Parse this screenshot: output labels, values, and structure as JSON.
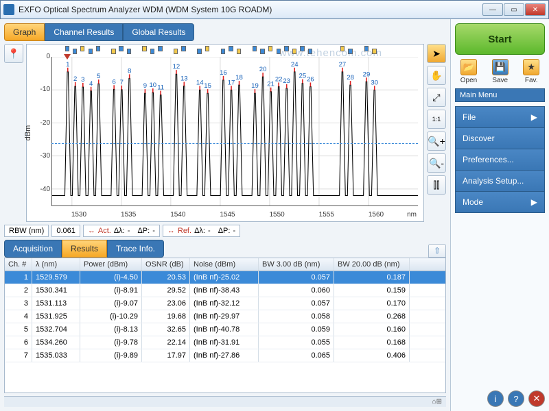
{
  "window": {
    "title": "EXFO Optical Spectrum Analyzer WDM (WDM System 10G ROADM)"
  },
  "watermark": "www.tehencom.com",
  "top_tabs": {
    "graph": "Graph",
    "channel_results": "Channel Results",
    "global_results": "Global Results"
  },
  "chart_data": {
    "type": "line",
    "title": "",
    "xlabel": "nm",
    "ylabel": "dBm",
    "xlim": [
      1528,
      1565
    ],
    "ylim": [
      -45,
      0
    ],
    "xticks": [
      1530,
      1535,
      1540,
      1545,
      1550,
      1555,
      1560
    ],
    "yticks": [
      0,
      -10,
      -20,
      -30,
      -40
    ],
    "marker_line_dbm": -26,
    "channels": [
      {
        "n": 1,
        "wl": 1529.58,
        "pk": -4.5
      },
      {
        "n": 2,
        "wl": 1530.34,
        "pk": -8.9
      },
      {
        "n": 3,
        "wl": 1531.11,
        "pk": -9.1
      },
      {
        "n": 4,
        "wl": 1531.93,
        "pk": -10.3
      },
      {
        "n": 5,
        "wl": 1532.7,
        "pk": -8.1
      },
      {
        "n": 6,
        "wl": 1534.26,
        "pk": -9.8
      },
      {
        "n": 7,
        "wl": 1535.03,
        "pk": -9.9
      },
      {
        "n": 8,
        "wl": 1535.82,
        "pk": -6.5
      },
      {
        "n": 9,
        "wl": 1537.4,
        "pk": -11.0
      },
      {
        "n": 10,
        "wl": 1538.19,
        "pk": -10.8
      },
      {
        "n": 11,
        "wl": 1538.98,
        "pk": -11.5
      },
      {
        "n": 12,
        "wl": 1540.56,
        "pk": -5.2
      },
      {
        "n": 13,
        "wl": 1541.35,
        "pk": -8.8
      },
      {
        "n": 14,
        "wl": 1542.94,
        "pk": -10.0
      },
      {
        "n": 15,
        "wl": 1543.73,
        "pk": -11.0
      },
      {
        "n": 16,
        "wl": 1545.32,
        "pk": -7.0
      },
      {
        "n": 17,
        "wl": 1546.12,
        "pk": -10.0
      },
      {
        "n": 18,
        "wl": 1546.92,
        "pk": -8.5
      },
      {
        "n": 19,
        "wl": 1548.51,
        "pk": -11.0
      },
      {
        "n": 20,
        "wl": 1549.32,
        "pk": -6.0
      },
      {
        "n": 21,
        "wl": 1550.12,
        "pk": -10.5
      },
      {
        "n": 22,
        "wl": 1550.92,
        "pk": -9.0
      },
      {
        "n": 23,
        "wl": 1551.72,
        "pk": -9.5
      },
      {
        "n": 24,
        "wl": 1552.52,
        "pk": -4.5
      },
      {
        "n": 25,
        "wl": 1553.33,
        "pk": -8.0
      },
      {
        "n": 26,
        "wl": 1554.13,
        "pk": -9.0
      },
      {
        "n": 27,
        "wl": 1557.36,
        "pk": -4.5
      },
      {
        "n": 28,
        "wl": 1558.17,
        "pk": -8.5
      },
      {
        "n": 29,
        "wl": 1559.79,
        "pk": -7.5
      },
      {
        "n": 30,
        "wl": 1560.61,
        "pk": -10.0
      }
    ],
    "noise_floor_dbm": -42
  },
  "status": {
    "rbw_label": "RBW (nm)",
    "rbw_value": "0.061",
    "act_label": "Act.",
    "ref_label": "Ref.",
    "dl_label": "Δλ:",
    "dl_value": "-",
    "dp_label": "ΔP:",
    "dp_value": "-"
  },
  "bottom_tabs": {
    "acquisition": "Acquisition",
    "results": "Results",
    "trace_info": "Trace Info."
  },
  "table": {
    "headers": {
      "ch": "Ch. #",
      "wl": "λ (nm)",
      "power": "Power (dBm)",
      "osnr": "OSNR (dB)",
      "noise": "Noise (dBm)",
      "bw3": "BW 3.00 dB (nm)",
      "bw20": "BW 20.00 dB (nm)"
    },
    "rows": [
      {
        "ch": "1",
        "wl": "1529.579",
        "power": "(i)-4.50",
        "osnr": "20.53",
        "noise": "(InB nf)-25.02",
        "bw3": "0.057",
        "bw20": "0.187",
        "sel": true
      },
      {
        "ch": "2",
        "wl": "1530.341",
        "power": "(i)-8.91",
        "osnr": "29.52",
        "noise": "(InB nf)-38.43",
        "bw3": "0.060",
        "bw20": "0.159"
      },
      {
        "ch": "3",
        "wl": "1531.113",
        "power": "(i)-9.07",
        "osnr": "23.06",
        "noise": "(InB nf)-32.12",
        "bw3": "0.057",
        "bw20": "0.170"
      },
      {
        "ch": "4",
        "wl": "1531.925",
        "power": "(i)-10.29",
        "osnr": "19.68",
        "noise": "(InB nf)-29.97",
        "bw3": "0.058",
        "bw20": "0.268"
      },
      {
        "ch": "5",
        "wl": "1532.704",
        "power": "(i)-8.13",
        "osnr": "32.65",
        "noise": "(InB nf)-40.78",
        "bw3": "0.059",
        "bw20": "0.160"
      },
      {
        "ch": "6",
        "wl": "1534.260",
        "power": "(i)-9.78",
        "osnr": "22.14",
        "noise": "(InB nf)-31.91",
        "bw3": "0.055",
        "bw20": "0.168"
      },
      {
        "ch": "7",
        "wl": "1535.033",
        "power": "(i)-9.89",
        "osnr": "17.97",
        "noise": "(InB nf)-27.86",
        "bw3": "0.065",
        "bw20": "0.406"
      }
    ]
  },
  "sidebar": {
    "start": "Start",
    "open": "Open",
    "save": "Save",
    "fav": "Fav.",
    "menu_header": "Main Menu",
    "items": [
      "File",
      "Discover",
      "Preferences...",
      "Analysis Setup...",
      "Mode"
    ]
  },
  "left_tools": {
    "peak": "peak-marker"
  },
  "right_tools": [
    "cursor",
    "pan",
    "zoom-fit",
    "zoom-1to1",
    "zoom-in",
    "zoom-out",
    "channel-marker"
  ],
  "footer_icon": "⌂⊞"
}
